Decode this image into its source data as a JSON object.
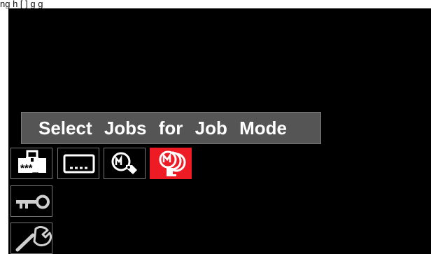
{
  "header_fragment": "ng   h       [  ]    g  g",
  "title_bar": {
    "text": "Select Jobs for Job Mode"
  },
  "menu": {
    "password_icon": {
      "symbol_text": "***_"
    }
  },
  "icons": {
    "password": "lock-password-icon",
    "display": "display-settings-icon",
    "memory_tag": "memory-tag-icon",
    "jobs": "job-selection-icon",
    "key": "key-icon",
    "wrench": "wrench-icon"
  },
  "colors": {
    "background": "#000000",
    "title_bar_bg": "#555555",
    "title_bar_text": "#ffffff",
    "active_icon_bg": "#ee1b24",
    "icon_border": "#777777"
  }
}
